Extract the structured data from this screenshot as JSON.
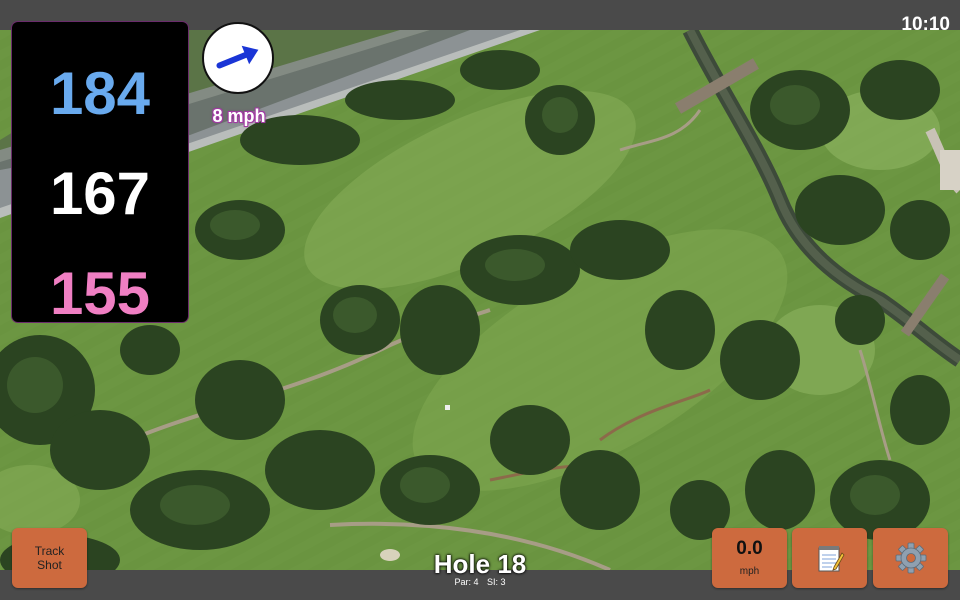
{
  "status_bar": {
    "time": "10:10"
  },
  "distances": {
    "back": "184",
    "middle": "167",
    "front": "155"
  },
  "wind": {
    "speed_label": "8 mph",
    "direction_icon": "wind-arrow-icon"
  },
  "hole": {
    "title": "Hole 18",
    "par_label": "Par: 4",
    "si_label": "SI: 3"
  },
  "buttons": {
    "track_shot_line1": "Track",
    "track_shot_line2": "Shot",
    "speed_value": "0.0",
    "speed_unit": "mph",
    "notes_icon": "notepad-icon",
    "settings_icon": "gear-icon"
  },
  "colors": {
    "back_distance": "#69aaee",
    "middle_distance": "#ffffff",
    "front_distance": "#f07fc3",
    "button_bg": "#cd6a3e",
    "panel_bg": "#000000"
  }
}
